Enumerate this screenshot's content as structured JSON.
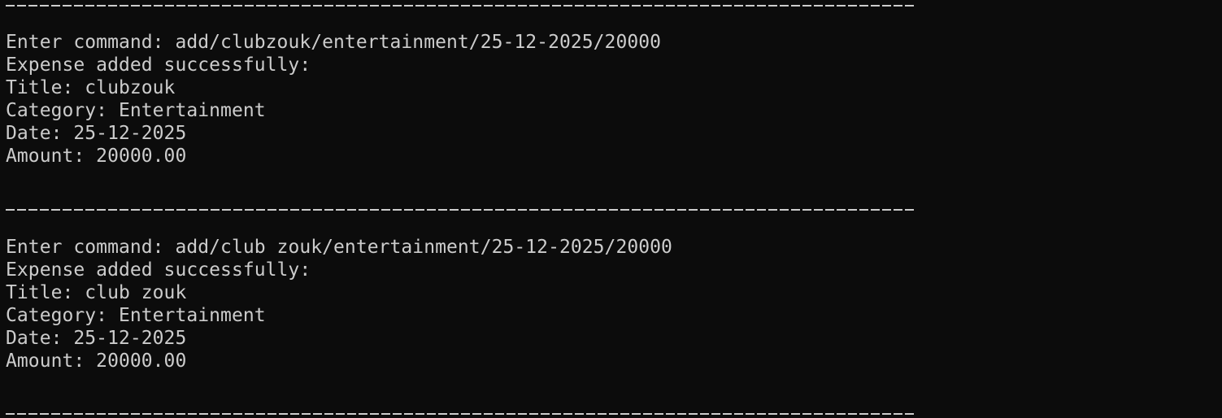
{
  "colors": {
    "background": "#0c0c0c",
    "foreground": "#cccccc"
  },
  "entries": [
    {
      "prompt": "Enter command: ",
      "command": "add/clubzouk/entertainment/25-12-2025/20000",
      "status": "Expense added successfully:",
      "title": "Title: clubzouk",
      "category": "Category: Entertainment",
      "date": "Date: 25-12-2025",
      "amount": "Amount: 20000.00"
    },
    {
      "prompt": "Enter command: ",
      "command": "add/club zouk/entertainment/25-12-2025/20000",
      "status": "Expense added successfully:",
      "title": "Title: club zouk",
      "category": "Category: Entertainment",
      "date": "Date: 25-12-2025",
      "amount": "Amount: 20000.00"
    }
  ]
}
